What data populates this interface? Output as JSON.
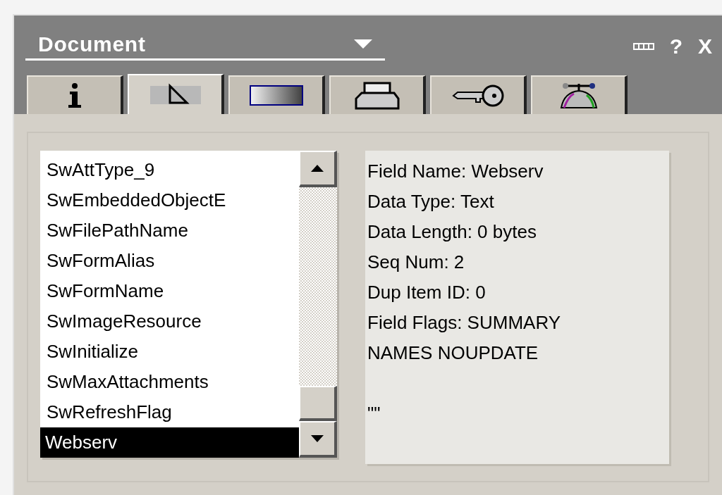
{
  "window": {
    "title": "Document",
    "help": "?",
    "close": "X"
  },
  "tabs": [
    {
      "selected": false
    },
    {
      "selected": true
    },
    {
      "selected": false
    },
    {
      "selected": false
    },
    {
      "selected": false
    },
    {
      "selected": false
    }
  ],
  "fields": [
    {
      "label": "SwAttType_9",
      "selected": false
    },
    {
      "label": "SwEmbeddedObjectE",
      "selected": false
    },
    {
      "label": "SwFilePathName",
      "selected": false
    },
    {
      "label": "SwFormAlias",
      "selected": false
    },
    {
      "label": "SwFormName",
      "selected": false
    },
    {
      "label": "SwImageResource",
      "selected": false
    },
    {
      "label": "SwInitialize",
      "selected": false
    },
    {
      "label": "SwMaxAttachments",
      "selected": false
    },
    {
      "label": "SwRefreshFlag",
      "selected": false
    },
    {
      "label": "Webserv",
      "selected": true
    }
  ],
  "details": [
    "Field Name: Webserv",
    "Data Type: Text",
    "Data Length: 0 bytes",
    "Seq Num: 2",
    "Dup Item ID: 0",
    "Field Flags: SUMMARY",
    "NAMES NOUPDATE",
    "\"\""
  ]
}
